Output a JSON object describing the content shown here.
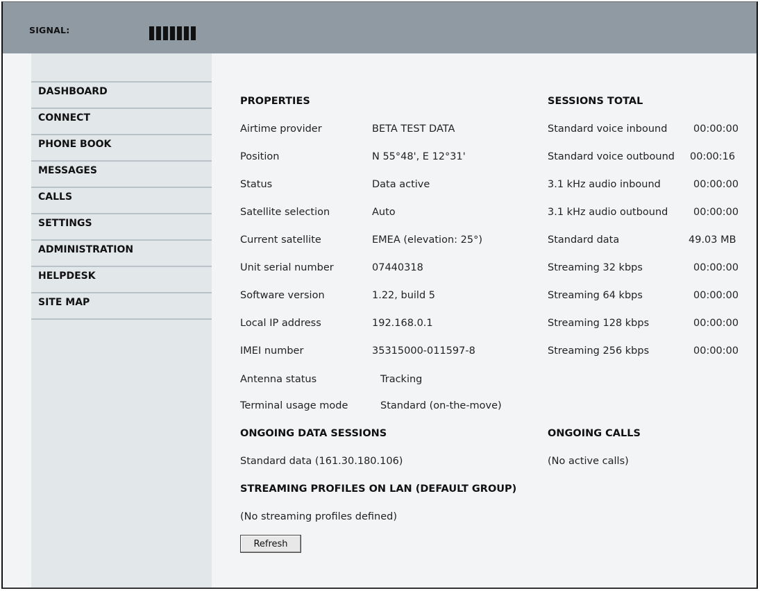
{
  "header": {
    "signal_label": "SIGNAL:",
    "signal_level": "7 of 7"
  },
  "sidebar": {
    "items": [
      {
        "label": "DASHBOARD"
      },
      {
        "label": "CONNECT"
      },
      {
        "label": "PHONE BOOK"
      },
      {
        "label": "MESSAGES"
      },
      {
        "label": "CALLS"
      },
      {
        "label": "SETTINGS"
      },
      {
        "label": "ADMINISTRATION"
      },
      {
        "label": "HELPDESK"
      },
      {
        "label": "SITE MAP"
      }
    ]
  },
  "properties": {
    "heading": "PROPERTIES",
    "rows": [
      {
        "label": "Airtime provider",
        "value": "BETA TEST DATA"
      },
      {
        "label": "Position",
        "value": "N 55°48', E 12°31'"
      },
      {
        "label": "Status",
        "value": "Data active"
      },
      {
        "label": "Satellite selection",
        "value": "Auto"
      },
      {
        "label": "Current satellite",
        "value": "EMEA (elevation: 25°)"
      },
      {
        "label": "Unit serial number",
        "value": "07440318"
      },
      {
        "label": "Software version",
        "value": "1.22, build 5"
      },
      {
        "label": "Local IP address",
        "value": "192.168.0.1"
      },
      {
        "label": "IMEI number",
        "value": "35315000-011597-8"
      },
      {
        "label": "Antenna status",
        "value": "Tracking"
      },
      {
        "label": "Terminal usage mode",
        "value": "Standard (on-the-move)"
      }
    ]
  },
  "sessions_total": {
    "heading": "SESSIONS TOTAL",
    "rows": [
      {
        "label": "Standard voice inbound",
        "value": "00:00:00"
      },
      {
        "label": "Standard voice outbound",
        "value": "00:00:16"
      },
      {
        "label": "3.1 kHz audio inbound",
        "value": "00:00:00"
      },
      {
        "label": "3.1 kHz audio outbound",
        "value": "00:00:00"
      },
      {
        "label": "Standard data",
        "value": "49.03 MB"
      },
      {
        "label": "Streaming 32 kbps",
        "value": "00:00:00"
      },
      {
        "label": "Streaming 64 kbps",
        "value": "00:00:00"
      },
      {
        "label": "Streaming 128 kbps",
        "value": "00:00:00"
      },
      {
        "label": "Streaming 256 kbps",
        "value": "00:00:00"
      }
    ]
  },
  "ongoing_data": {
    "heading": "ONGOING DATA SESSIONS",
    "text": "Standard data (161.30.180.106)"
  },
  "ongoing_calls": {
    "heading": "ONGOING CALLS",
    "text": "(No active calls)"
  },
  "streaming_profiles": {
    "heading": "STREAMING PROFILES ON LAN (DEFAULT GROUP)",
    "text": "(No streaming profiles defined)"
  },
  "refresh_label": "Refresh"
}
